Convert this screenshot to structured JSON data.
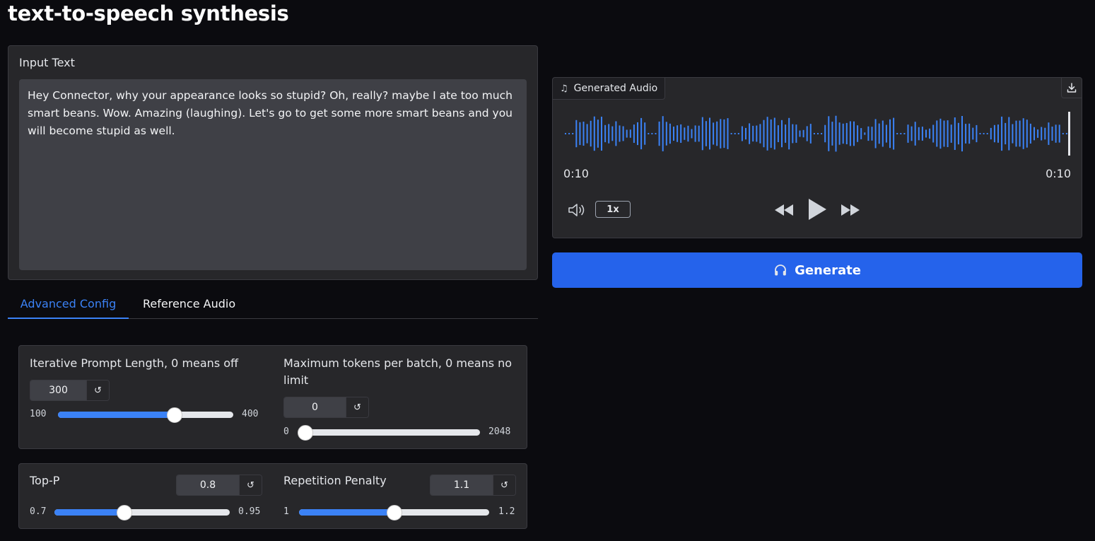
{
  "page": {
    "title": "text-to-speech synthesis"
  },
  "input": {
    "label": "Input Text",
    "value": "Hey Connector, why your appearance looks so stupid? Oh, really? maybe I ate too much smart beans. Wow. Amazing (laughing). Let's go to get some more smart beans and you will become stupid as well."
  },
  "tabs": [
    {
      "label": "Advanced Config",
      "active": true
    },
    {
      "label": "Reference Audio",
      "active": false
    }
  ],
  "config": {
    "iterative_prompt_length": {
      "label": "Iterative Prompt Length, 0 means off",
      "value": "300",
      "min": "100",
      "max": "400",
      "fraction": 0.6667
    },
    "max_tokens_per_batch": {
      "label": "Maximum tokens per batch, 0 means no limit",
      "value": "0",
      "min": "0",
      "max": "2048",
      "fraction": 0.0
    },
    "top_p": {
      "label": "Top-P",
      "value": "0.8",
      "min": "0.7",
      "max": "0.95",
      "fraction": 0.4
    },
    "repetition_penalty": {
      "label": "Repetition Penalty",
      "value": "1.1",
      "min": "1",
      "max": "1.2",
      "fraction": 0.5
    }
  },
  "icons": {
    "reset": "reset-icon",
    "music": "music-note-icon",
    "download": "download-icon",
    "volume": "volume-icon",
    "rewind": "rewind-icon",
    "play": "play-icon",
    "fast_forward": "fast-forward-icon",
    "headphones": "headphones-icon"
  },
  "audio": {
    "label": "Generated Audio",
    "current_time": "0:10",
    "total_time": "0:10",
    "speed": "1x"
  },
  "generate": {
    "label": "Generate"
  },
  "colors": {
    "accent": "#3b82f6",
    "primary_button": "#2563eb",
    "background": "#0b0b0f",
    "panel": "#27272a"
  }
}
